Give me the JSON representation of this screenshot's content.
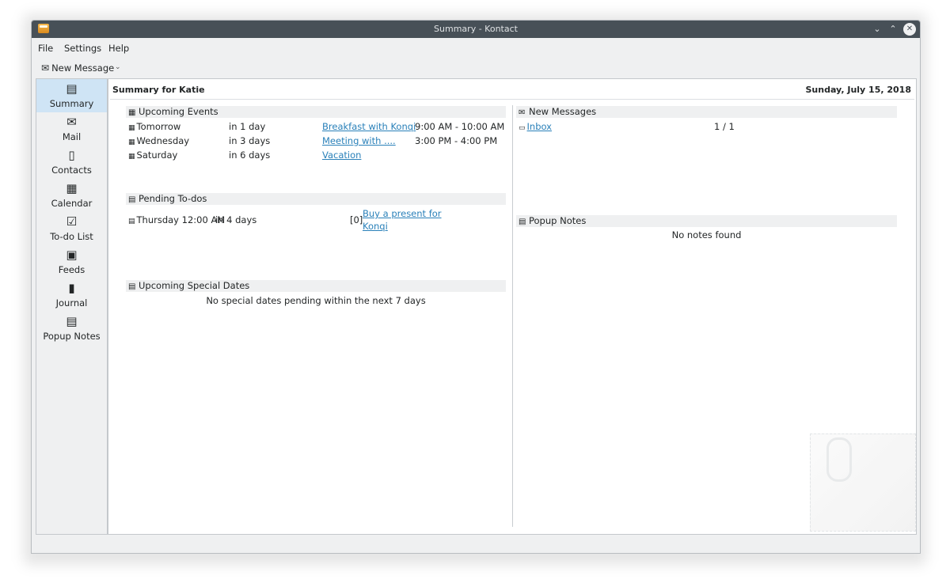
{
  "window": {
    "title": "Summary - Kontact"
  },
  "menu": [
    "File",
    "Settings",
    "Help"
  ],
  "toolbar": {
    "new_message_label": "New Message"
  },
  "sidebar": {
    "items": [
      {
        "label": "Summary",
        "icon": "summary-icon",
        "active": true
      },
      {
        "label": "Mail",
        "icon": "mail-icon"
      },
      {
        "label": "Contacts",
        "icon": "contacts-icon"
      },
      {
        "label": "Calendar",
        "icon": "calendar-icon"
      },
      {
        "label": "To-do List",
        "icon": "todo-icon"
      },
      {
        "label": "Feeds",
        "icon": "feeds-icon"
      },
      {
        "label": "Journal",
        "icon": "journal-icon"
      },
      {
        "label": "Popup Notes",
        "icon": "notes-icon"
      }
    ]
  },
  "summary": {
    "heading": "Summary for Katie",
    "date": "Sunday, July 15, 2018",
    "upcoming_events": {
      "title": "Upcoming Events",
      "rows": [
        {
          "day": "Tomorrow",
          "rel": "in 1 day",
          "event": "Breakfast with Konqi",
          "time": "9:00 AM - 10:00 AM"
        },
        {
          "day": "Wednesday",
          "rel": "in 3 days",
          "event": "Meeting with ....",
          "time": "3:00 PM - 4:00 PM"
        },
        {
          "day": "Saturday",
          "rel": "in 6 days",
          "event": "Vacation",
          "time": ""
        }
      ]
    },
    "pending_todos": {
      "title": "Pending To-dos",
      "rows": [
        {
          "when": "Thursday 12:00 AM",
          "rel": "in 4 days",
          "priority": "[0]",
          "task_line1": "Buy a present for",
          "task_line2": "Konqi"
        }
      ]
    },
    "special_dates": {
      "title": "Upcoming Special Dates",
      "empty_text": "No special dates pending within the next 7 days"
    },
    "new_messages": {
      "title": "New Messages",
      "rows": [
        {
          "folder": "Inbox",
          "count": "1 / 1"
        }
      ]
    },
    "popup_notes": {
      "title": "Popup Notes",
      "empty_text": "No notes found"
    }
  },
  "colors": {
    "accent": "#2980b9",
    "titlebar": "#475057",
    "selection": "#cfe4f5"
  }
}
